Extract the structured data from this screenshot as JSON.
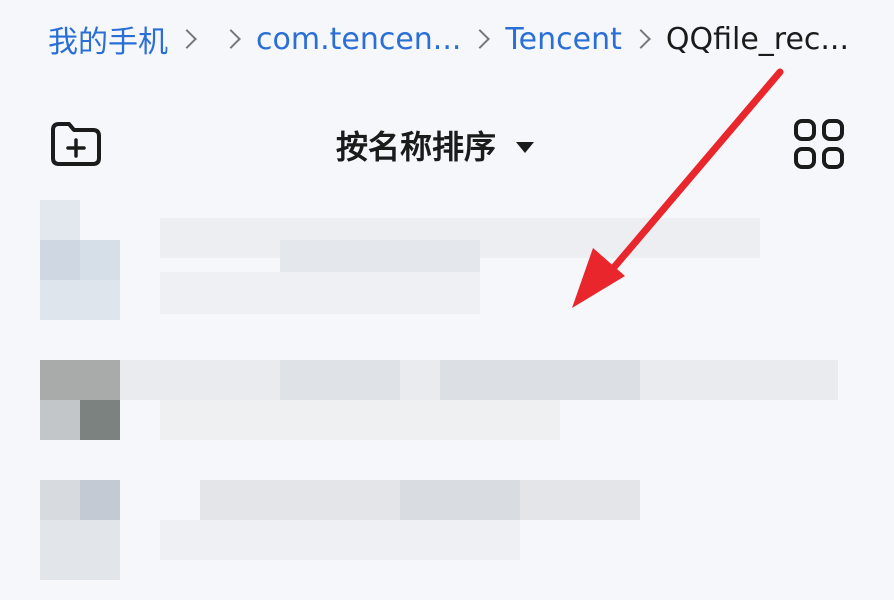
{
  "breadcrumb": {
    "items": [
      "我的手机",
      "com.tencen...",
      "Tencent",
      "QQfile_rec..."
    ]
  },
  "toolbar": {
    "new_folder_icon": "folder-plus-icon",
    "sort_label": "按名称排序",
    "sort_caret_icon": "caret-down-icon",
    "view_toggle_icon": "grid-view-icon"
  },
  "file_list": {
    "rows_blurred": 3
  },
  "annotation": {
    "arrow_color": "#e8262b"
  },
  "colors": {
    "link": "#2a6fd6",
    "text": "#1b1b1b",
    "background": "#f6f7fa"
  }
}
